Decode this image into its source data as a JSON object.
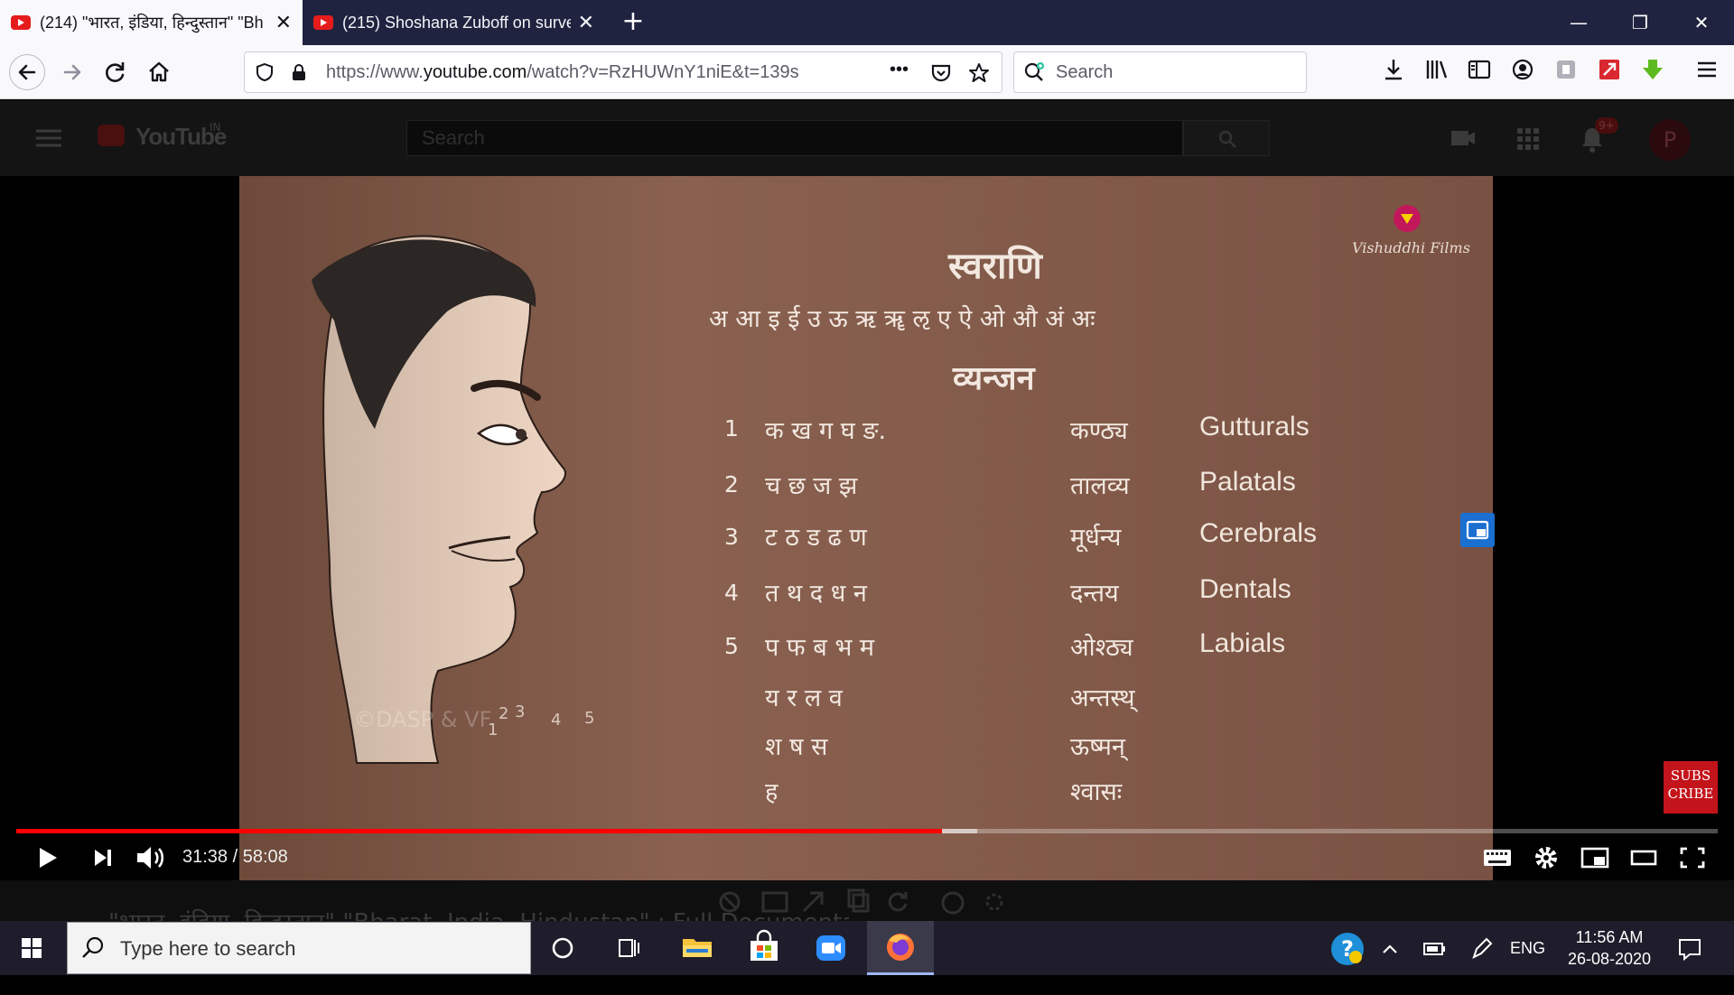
{
  "browser": {
    "tabs": [
      {
        "title": "(214) \"भारत, इंडिया, हिन्दुस्तान\" \"Bh",
        "active": true
      },
      {
        "title": "(215) Shoshana Zuboff on surve",
        "active": false
      }
    ],
    "new_tab_label": "+",
    "window_controls": {
      "minimize": "—",
      "restore": "❐",
      "close": "✕"
    },
    "url": {
      "prefix": "https://www.",
      "domain": "youtube.com",
      "path": "/watch?v=RzHUWnY1niE&t=139s"
    },
    "page_actions_label": "•••",
    "search_placeholder": "Search"
  },
  "youtube": {
    "logo_text": "YouTube",
    "region": "IN",
    "search_placeholder": "Search",
    "notification_count": "9+",
    "avatar_letter": "P"
  },
  "video": {
    "watermark_brand": "Vishuddhi Films",
    "copyright": "©DASP & VF",
    "svarani_heading": "स्वराणि",
    "vowels": "अ  आ  इ  ई उ ऊ ऋ ॠ  ऌ ए ऐ ओ औ अं अः",
    "vyanjan_heading": "व्यन्जन",
    "rows": [
      {
        "num": "1",
        "letters": "क   ख   ग   घ ङ.",
        "sanskrit": "कण्ठ्य",
        "english": "Gutturals"
      },
      {
        "num": "2",
        "letters": "च   छ   ज   झ",
        "sanskrit": "तालव्य",
        "english": "Palatals"
      },
      {
        "num": "3",
        "letters": "ट   ठ   ड ढ ण",
        "sanskrit": "मूर्धन्य",
        "english": "Cerebrals"
      },
      {
        "num": "4",
        "letters": "त   थ   द ध न",
        "sanskrit": "दन्तय",
        "english": "Dentals"
      },
      {
        "num": "5",
        "letters": "प   फ   ब भ म",
        "sanskrit": "ओश्ठ्य",
        "english": "Labials"
      },
      {
        "num": "",
        "letters": "य   र   ल व",
        "sanskrit": "अन्तस्थ्",
        "english": ""
      },
      {
        "num": "",
        "letters": "श ष स",
        "sanskrit": "ऊष्मन्",
        "english": ""
      },
      {
        "num": "",
        "letters": "ह",
        "sanskrit": "श्वासः",
        "english": ""
      }
    ],
    "mouth_labels": [
      "1",
      "2",
      "3",
      "4",
      "5"
    ],
    "subscribe_label": "SUBS CRIBE"
  },
  "player": {
    "current_time": "31:38",
    "duration": "58:08",
    "timecode_separator": " / ",
    "progress_fraction": 0.544,
    "buffered_fraction": 0.565
  },
  "below_video": {
    "title": "\"भारत, इंडिया, हिन्दुस्तान\" \"Bharat, India, Hindustan\" : Full Documentary"
  },
  "taskbar": {
    "search_placeholder": "Type here to search",
    "language": "ENG",
    "time": "11:56 AM",
    "date": "26-08-2020"
  }
}
